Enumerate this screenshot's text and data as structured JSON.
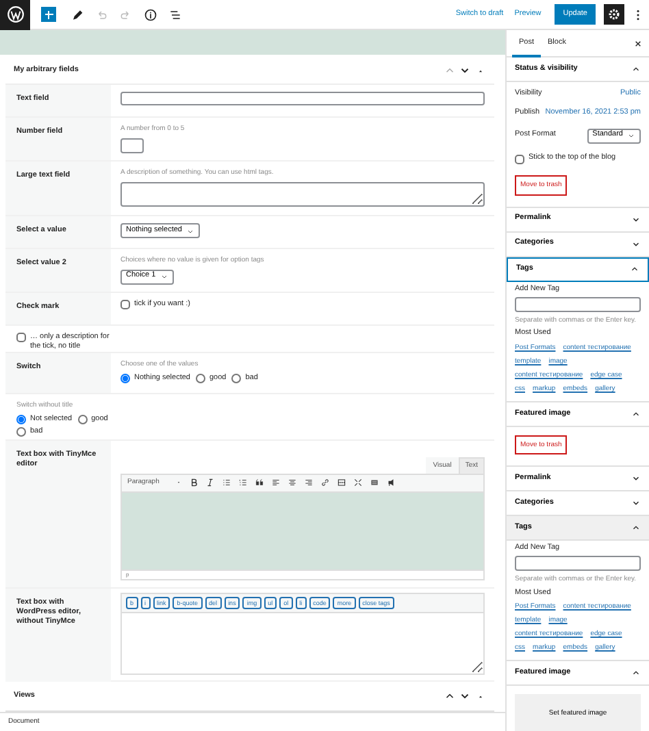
{
  "toolbar": {
    "undo_disabled": true,
    "redo_disabled": true,
    "switch_to_draft": "Switch to draft",
    "preview": "Preview",
    "update": "Update",
    "settings_on": true
  },
  "metabox": {
    "title": "My arbitrary fields",
    "rows": [
      {
        "kind": "text",
        "label": "Text field"
      },
      {
        "kind": "number",
        "label": "Number field",
        "description": "A number from 0 to 5"
      },
      {
        "kind": "textarea",
        "label": "Large text field",
        "description": "A description of something. You can use html tags."
      },
      {
        "kind": "select",
        "label": "Select a value",
        "value": "Nothing selected"
      },
      {
        "kind": "select",
        "label": "Select value 2",
        "description": "Choices where no value is given for option tags",
        "value": "Choice 1"
      },
      {
        "kind": "check",
        "label": "Check mark",
        "option": "tick if you want :)",
        "checked": false
      },
      {
        "kind": "check_full",
        "option": "… only a description for the tick, no title",
        "checked": false
      },
      {
        "kind": "radio",
        "label": "Switch",
        "description": "Choose one of the values",
        "options": [
          {
            "label": "Nothing selected",
            "selected": true
          },
          {
            "label": "good",
            "selected": false
          },
          {
            "label": "bad",
            "selected": false
          }
        ]
      },
      {
        "kind": "radio_full",
        "description": "Switch without title",
        "options": [
          {
            "label": "Not selected",
            "selected": true
          },
          {
            "label": "good",
            "selected": false
          },
          {
            "label": "bad",
            "selected": false
          }
        ]
      },
      {
        "kind": "tinymce",
        "label": "Text box with TinyMce editor",
        "tabs": [
          {
            "label": "Visual",
            "selected": true
          },
          {
            "label": "Text",
            "selected": false
          }
        ],
        "format": "Paragraph",
        "path": "p"
      },
      {
        "kind": "quicktags",
        "label": "Text box with WordPress editor, without TinyMce",
        "buttons": [
          "b",
          "i",
          "link",
          "b-quote",
          "del",
          "ins",
          "img",
          "ul",
          "ol",
          "li",
          "code",
          "more",
          "close tags"
        ]
      }
    ]
  },
  "views": {
    "title": "Views"
  },
  "footer": "Document",
  "sidebar": {
    "tabs": [
      {
        "label": "Post",
        "selected": true
      },
      {
        "label": "Block",
        "selected": false
      }
    ],
    "panels": [
      {
        "kind": "status",
        "title": "Status & visibility",
        "expanded": true,
        "visibility_label": "Visibility",
        "visibility": "Public",
        "publish_label": "Publish",
        "publish": "November 16, 2021 2:53 pm",
        "format_label": "Post Format",
        "format": "Standard",
        "stick_label": "Stick to the top of the blog",
        "stick_checked": false,
        "trash": "Move to trash"
      },
      {
        "title": "Permalink",
        "expanded": false
      },
      {
        "title": "Categories",
        "expanded": false
      },
      {
        "kind": "tags",
        "title": "Tags",
        "expanded": true,
        "focused": true,
        "hovered": false,
        "add_label": "Add New Tag",
        "hint": "Separate with commas or the Enter key.",
        "most_used": "Most Used",
        "tags": [
          "Post Formats",
          "content тестирование",
          "template",
          "image",
          "content тестирование",
          "edge case",
          "css",
          "markup",
          "embeds",
          "gallery"
        ]
      },
      {
        "kind": "featured",
        "title": "Featured image",
        "expanded": true,
        "trash": "Move to trash"
      },
      {
        "title": "Permalink",
        "expanded": false
      },
      {
        "title": "Categories",
        "expanded": false
      },
      {
        "kind": "tags",
        "title": "Tags",
        "expanded": true,
        "focused": false,
        "hovered": true,
        "add_label": "Add New Tag",
        "hint": "Separate with commas or the Enter key.",
        "most_used": "Most Used",
        "tags": [
          "Post Formats",
          "content тестирование",
          "template",
          "image",
          "content тестирование",
          "edge case",
          "css",
          "markup",
          "embeds",
          "gallery"
        ]
      },
      {
        "kind": "featured",
        "title": "Featured image",
        "expanded": true,
        "button": "Set featured image"
      }
    ]
  }
}
